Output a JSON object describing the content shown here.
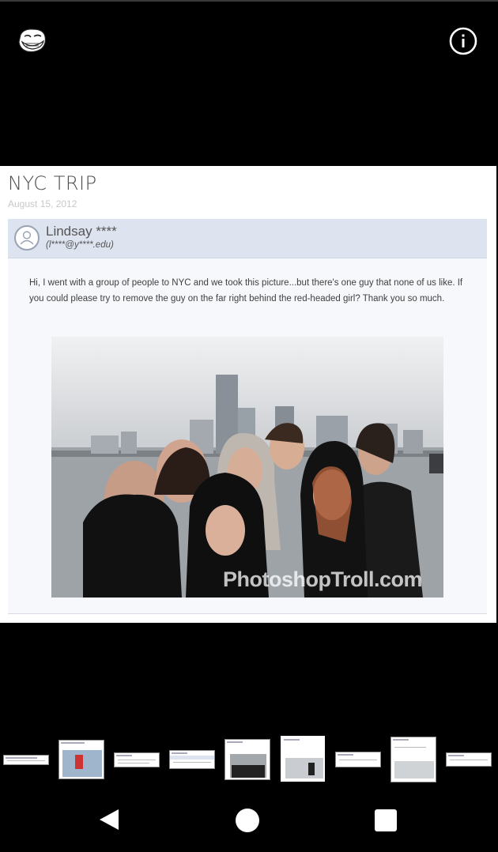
{
  "post": {
    "title": "NYC TRIP",
    "date": "August 15, 2012",
    "sender_name": "Lindsay ****",
    "sender_email": "(l****@y****.edu)",
    "message": "Hi, I went with a group of people to NYC and we took this picture...but there's one guy that none of us like. If you could please try to remove the guy on the far right behind the red-headed girl? Thank you so much.",
    "watermark": "PhotoshopTroll.com"
  },
  "icons": {
    "troll": "troll-face-icon",
    "info": "info-icon",
    "back": "nav-back-icon",
    "home": "nav-home-icon",
    "recents": "nav-recents-icon"
  },
  "thumbnail_count": 9
}
